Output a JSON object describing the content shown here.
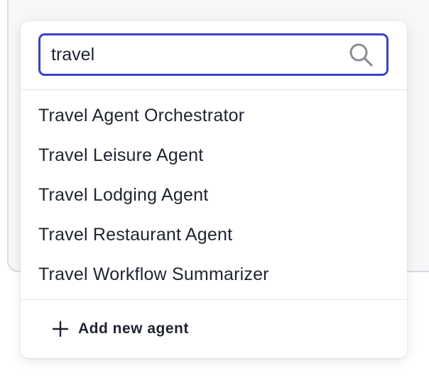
{
  "search": {
    "value": "travel",
    "icon": "search-icon"
  },
  "options": [
    {
      "label": "Travel Agent Orchestrator"
    },
    {
      "label": "Travel Leisure Agent"
    },
    {
      "label": "Travel Lodging Agent"
    },
    {
      "label": "Travel Restaurant Agent"
    },
    {
      "label": "Travel Workflow Summarizer"
    }
  ],
  "footer": {
    "add_label": "Add new agent",
    "add_icon": "plus-icon"
  },
  "colors": {
    "accent": "#3b42c4",
    "text": "#1f2430",
    "divider": "#e4e6ea",
    "background_panel": "#f6f7f9"
  }
}
